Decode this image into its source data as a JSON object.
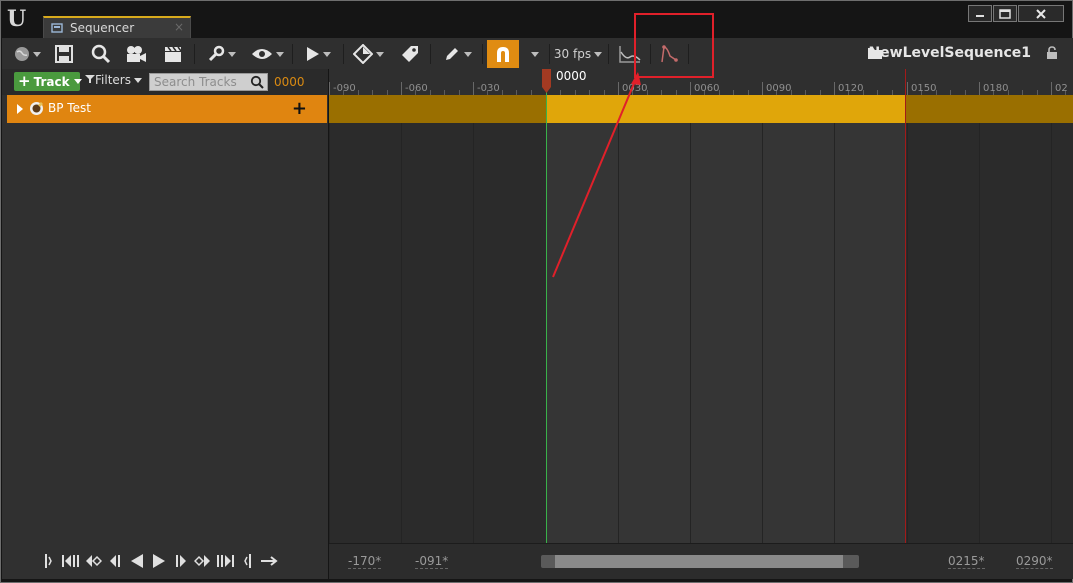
{
  "title_bar": {
    "logo": "U",
    "tab_label": "Sequencer",
    "tab_close": "×",
    "window_buttons": [
      "minimize-icon",
      "maximize-icon",
      "close-icon"
    ]
  },
  "toolbar": {
    "icons": [
      "world-icon",
      "save-icon",
      "search-icon",
      "camera-icon",
      "clapper-icon",
      "wrench-icon",
      "eye-icon",
      "play-icon",
      "key-icon",
      "tag-icon",
      "pencil-icon",
      "magnet-icon",
      "curve-editor-icon",
      "auto-tangent-icon"
    ],
    "fps_label": "30 fps",
    "sequence_name": "NewLevelSequence1",
    "snap_color": "#e08c12"
  },
  "track_panel": {
    "add_track_label": "Track",
    "filters_label": "Filters",
    "search_placeholder": "Search Tracks",
    "current_time": "0000",
    "tracks": [
      {
        "label": "BP Test",
        "add_label": "+"
      }
    ]
  },
  "timeline": {
    "playhead_time": "0000",
    "ruler_labels": [
      "-090",
      "-060",
      "-030",
      "0030",
      "0060",
      "0090",
      "0120",
      "0150",
      "0180",
      "02"
    ]
  },
  "bottom": {
    "view_start": "-170*",
    "working_start": "-091*",
    "working_end": "0215*",
    "view_end": "0290*"
  },
  "colors": {
    "track_row": "#e08510",
    "section": "#e0a60a",
    "playhead": "#39b24a",
    "end_marker": "#a31a1a",
    "annotation": "#e0202a"
  }
}
